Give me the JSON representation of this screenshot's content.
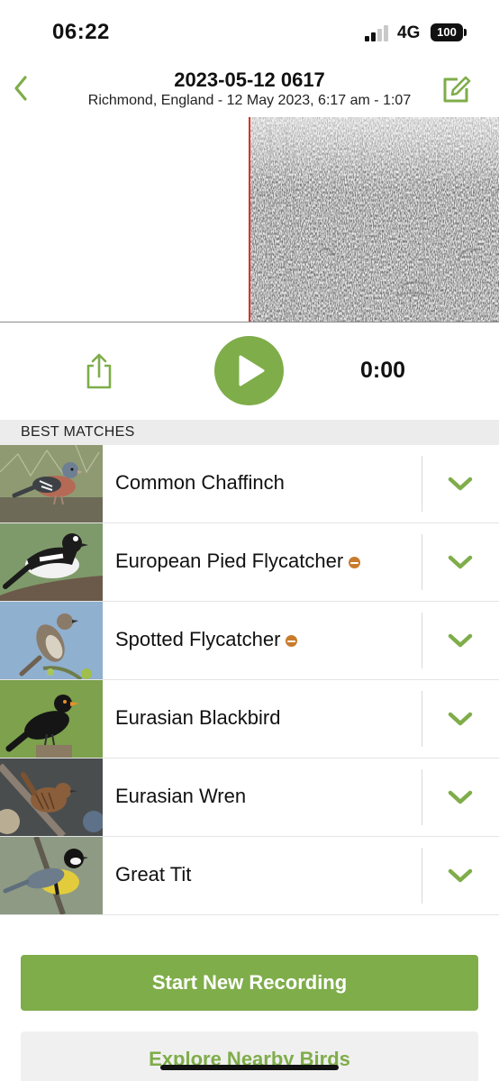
{
  "status_bar": {
    "time": "06:22",
    "network": "4G",
    "battery": "100"
  },
  "header": {
    "title": "2023-05-12 0617",
    "subtitle": "Richmond, England - 12 May 2023, 6:17 am - 1:07",
    "back_icon": "chevron-left-icon",
    "edit_icon": "edit-icon"
  },
  "player": {
    "time": "0:00",
    "share_icon": "share-icon",
    "play_icon": "play-icon"
  },
  "section": {
    "title": "BEST MATCHES"
  },
  "matches": [
    {
      "name": "Common Chaffinch",
      "rare": false,
      "thumb": "chaffinch"
    },
    {
      "name": "European Pied Flycatcher",
      "rare": true,
      "thumb": "pied-flycatcher"
    },
    {
      "name": "Spotted Flycatcher",
      "rare": true,
      "thumb": "spotted-flycatcher"
    },
    {
      "name": "Eurasian Blackbird",
      "rare": false,
      "thumb": "blackbird"
    },
    {
      "name": "Eurasian Wren",
      "rare": false,
      "thumb": "wren"
    },
    {
      "name": "Great Tit",
      "rare": false,
      "thumb": "great-tit"
    }
  ],
  "buttons": {
    "start": "Start New Recording",
    "explore": "Explore Nearby Birds"
  },
  "colors": {
    "accent": "#7fad4a",
    "playhead": "#d8322e",
    "rare_badge": "#c97b2c"
  }
}
